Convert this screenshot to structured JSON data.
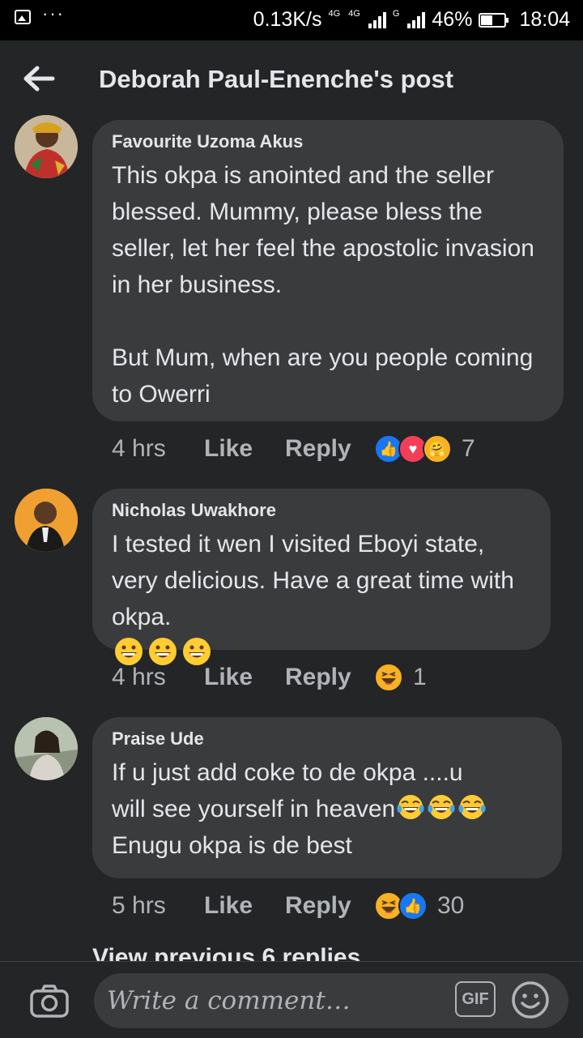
{
  "status_bar": {
    "speed": "0.13K/s",
    "net1": "4G",
    "net2": "4G",
    "net3": "G",
    "battery": "46%",
    "time": "18:04"
  },
  "header": {
    "title": "Deborah Paul-Enenche's post"
  },
  "comments": [
    {
      "author": "Favourite Uzoma Akus",
      "text": "This okpa is anointed and the seller blessed. Mummy, please bless the seller, let her feel the apostolic invasion in her business.\n\nBut Mum, when are you people coming to Owerri",
      "time": "4 hrs",
      "like": "Like",
      "reply": "Reply",
      "reactions": [
        "like",
        "love",
        "care"
      ],
      "reaction_count": "7"
    },
    {
      "author": "Nicholas Uwakhore",
      "text": "I tested it wen I visited Eboyi state, very delicious. Have a great time with okpa.",
      "emojis": [
        "grinning-face",
        "grinning-face",
        "grinning-face"
      ],
      "time": "4 hrs",
      "like": "Like",
      "reply": "Reply",
      "reactions": [
        "haha"
      ],
      "reaction_count": "1"
    },
    {
      "author": "Praise Ude",
      "text_line1": "If u just add coke to de okpa ....u",
      "text_line2": "will see yourself in heaven",
      "text_line3": "Enugu okpa is de best",
      "emojis": [
        "tears-of-joy",
        "tears-of-joy",
        "tears-of-joy"
      ],
      "time": "5 hrs",
      "like": "Like",
      "reply": "Reply",
      "reactions": [
        "haha",
        "like"
      ],
      "reaction_count": "30"
    }
  ],
  "view_previous": "View previous 6 replies",
  "composer": {
    "placeholder": "Write a comment…",
    "gif_label": "GIF"
  },
  "colors": {
    "background": "#242526",
    "bubble": "#3a3b3c",
    "text": "#e4e6eb",
    "muted": "#b0b3b8",
    "like_blue": "#1877f2"
  }
}
